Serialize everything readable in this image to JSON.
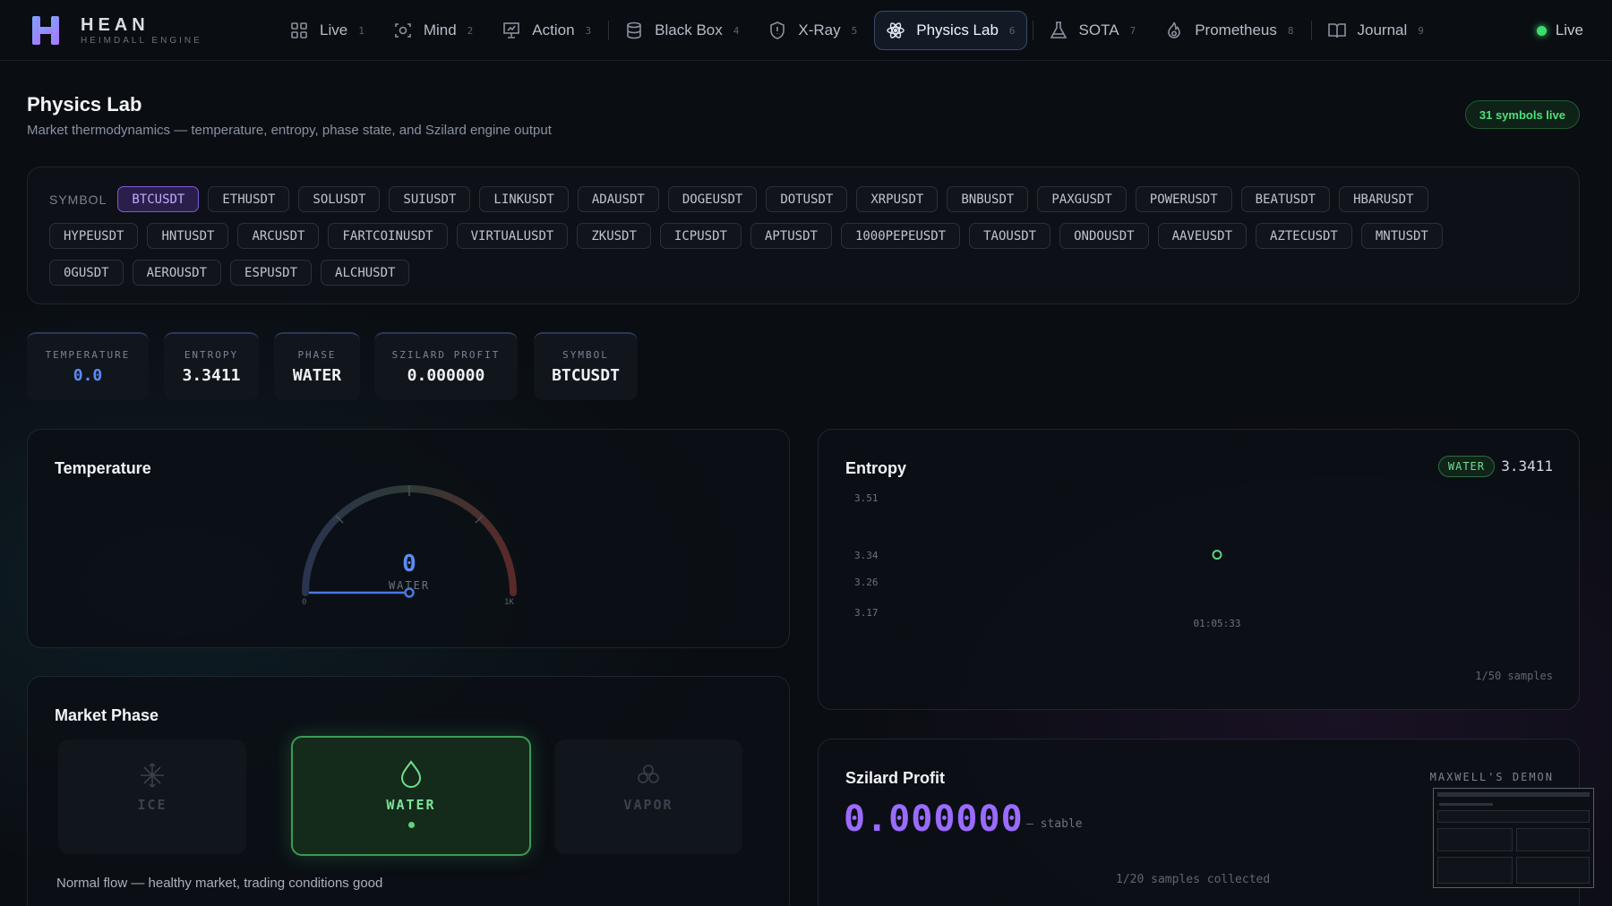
{
  "brand": {
    "name": "HEAN",
    "subtitle": "HEIMDALL ENGINE"
  },
  "nav": [
    {
      "label": "Live",
      "num": "1",
      "icon": "grid-icon"
    },
    {
      "label": "Mind",
      "num": "2",
      "icon": "scan-face-icon"
    },
    {
      "label": "Action",
      "num": "3",
      "icon": "presentation-chart-icon"
    },
    {
      "label": "Black Box",
      "num": "4",
      "icon": "database-icon"
    },
    {
      "label": "X-Ray",
      "num": "5",
      "icon": "shield-icon"
    },
    {
      "label": "Physics Lab",
      "num": "6",
      "icon": "atom-icon",
      "active": true
    },
    {
      "label": "SOTA",
      "num": "7",
      "icon": "flask-icon"
    },
    {
      "label": "Prometheus",
      "num": "8",
      "icon": "flame-icon"
    },
    {
      "label": "Journal",
      "num": "9",
      "icon": "book-icon"
    }
  ],
  "status": {
    "label": "Live",
    "color": "#3ddc6b"
  },
  "header": {
    "title": "Physics Lab",
    "subtitle": "Market thermodynamics — temperature, entropy, phase state, and Szilard engine output",
    "badge": "31 symbols live"
  },
  "symbols": {
    "label": "SYMBOL",
    "selected": "BTCUSDT",
    "row1": [
      "BTCUSDT",
      "ETHUSDT",
      "SOLUSDT",
      "SUIUSDT",
      "LINKUSDT",
      "ADAUSDT",
      "DOGEUSDT",
      "DOTUSDT",
      "XRPUSDT",
      "BNBUSDT",
      "PAXGUSDT",
      "POWERUSDT",
      "BEATUSDT",
      "HBARUSDT"
    ],
    "row2": [
      "HYPEUSDT",
      "HNTUSDT",
      "ARCUSDT",
      "FARTCOINUSDT",
      "VIRTUALUSDT",
      "ZKUSDT",
      "ICPUSDT",
      "APTUSDT",
      "1000PEPEUSDT",
      "TAOUSDT",
      "ONDOUSDT",
      "AAVEUSDT",
      "AZTECUSDT",
      "MNTUSDT"
    ],
    "row3": [
      "0GUSDT",
      "AEROUSDT",
      "ESPUSDT",
      "ALCHUSDT"
    ]
  },
  "stats": {
    "temperature": {
      "label": "TEMPERATURE",
      "value": "0.0"
    },
    "entropy": {
      "label": "ENTROPY",
      "value": "3.3411"
    },
    "phase": {
      "label": "PHASE",
      "value": "WATER"
    },
    "szilard": {
      "label": "SZILARD PROFIT",
      "value": "0.000000"
    },
    "symbol": {
      "label": "SYMBOL",
      "value": "BTCUSDT"
    }
  },
  "temperature_panel": {
    "title": "Temperature",
    "value": "0",
    "phase": "WATER",
    "min_label": "0",
    "max_label": "1K",
    "level": 0
  },
  "phase_panel": {
    "title": "Market Phase",
    "phases": [
      "ICE",
      "WATER",
      "VAPOR"
    ],
    "active": "WATER",
    "description": "Normal flow — healthy market, trading conditions good"
  },
  "entropy_panel": {
    "title": "Entropy",
    "phase_badge": "WATER",
    "value": "3.3411",
    "y_ticks": [
      "3.51",
      "3.34",
      "3.26",
      "3.17"
    ],
    "x_tick": "01:05:33",
    "samples": "1/50 samples",
    "point_color": "#5fd37f"
  },
  "chart_data": {
    "type": "line",
    "x": [
      "01:05:33"
    ],
    "series": [
      {
        "values": [
          3.3411
        ]
      }
    ],
    "ylim": [
      3.17,
      3.51
    ]
  },
  "szilard_panel": {
    "title": "Szilard Profit",
    "demon_label": "MAXWELL'S DEMON",
    "value": "0.000000",
    "trend": "— stable",
    "samples": "1/20 samples collected"
  }
}
